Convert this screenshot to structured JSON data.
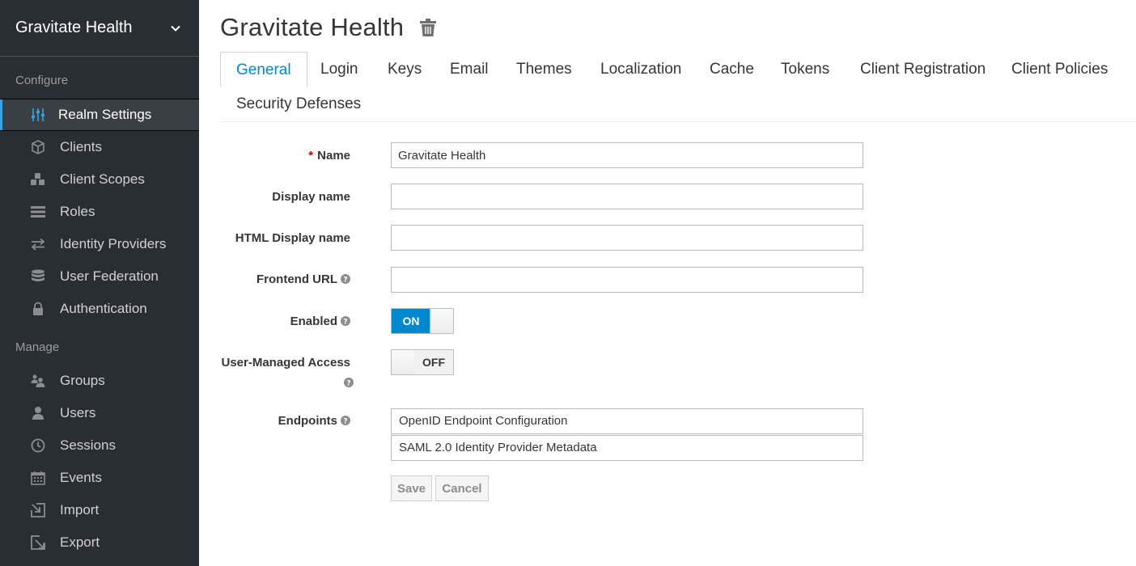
{
  "sidebar": {
    "realm_name": "Gravitate Health",
    "sections": {
      "configure": "Configure",
      "manage": "Manage"
    },
    "configure_items": [
      {
        "label": "Realm Settings",
        "icon": "sliders-icon",
        "active": true
      },
      {
        "label": "Clients",
        "icon": "cube-icon"
      },
      {
        "label": "Client Scopes",
        "icon": "cubes-icon"
      },
      {
        "label": "Roles",
        "icon": "list-icon"
      },
      {
        "label": "Identity Providers",
        "icon": "exchange-icon"
      },
      {
        "label": "User Federation",
        "icon": "database-icon"
      },
      {
        "label": "Authentication",
        "icon": "lock-icon"
      }
    ],
    "manage_items": [
      {
        "label": "Groups",
        "icon": "users-icon"
      },
      {
        "label": "Users",
        "icon": "user-icon"
      },
      {
        "label": "Sessions",
        "icon": "clock-icon"
      },
      {
        "label": "Events",
        "icon": "calendar-icon"
      },
      {
        "label": "Import",
        "icon": "import-icon"
      },
      {
        "label": "Export",
        "icon": "export-icon"
      }
    ]
  },
  "header": {
    "title": "Gravitate Health",
    "delete_icon": "trash-icon"
  },
  "tabs": [
    {
      "label": "General",
      "active": true
    },
    {
      "label": "Login"
    },
    {
      "label": "Keys"
    },
    {
      "label": "Email"
    },
    {
      "label": "Themes"
    },
    {
      "label": "Localization"
    },
    {
      "label": "Cache"
    },
    {
      "label": "Tokens"
    },
    {
      "label": "Client Registration"
    },
    {
      "label": "Client Policies"
    },
    {
      "label": "Security Defenses"
    }
  ],
  "form": {
    "name": {
      "label": "Name",
      "required_mark": "*",
      "value": "Gravitate Health"
    },
    "display_name": {
      "label": "Display name",
      "value": ""
    },
    "html_display_name": {
      "label": "HTML Display name",
      "value": ""
    },
    "frontend_url": {
      "label": "Frontend URL",
      "value": ""
    },
    "enabled": {
      "label": "Enabled",
      "state": "ON"
    },
    "user_managed_access": {
      "label": "User-Managed Access",
      "state": "OFF"
    },
    "endpoints": {
      "label": "Endpoints",
      "links": [
        "OpenID Endpoint Configuration",
        "SAML 2.0 Identity Provider Metadata"
      ]
    }
  },
  "buttons": {
    "save": "Save",
    "cancel": "Cancel"
  },
  "colors": {
    "sidebar_bg": "#292e34",
    "accent": "#0088ce",
    "active_bar": "#39a5dc"
  }
}
